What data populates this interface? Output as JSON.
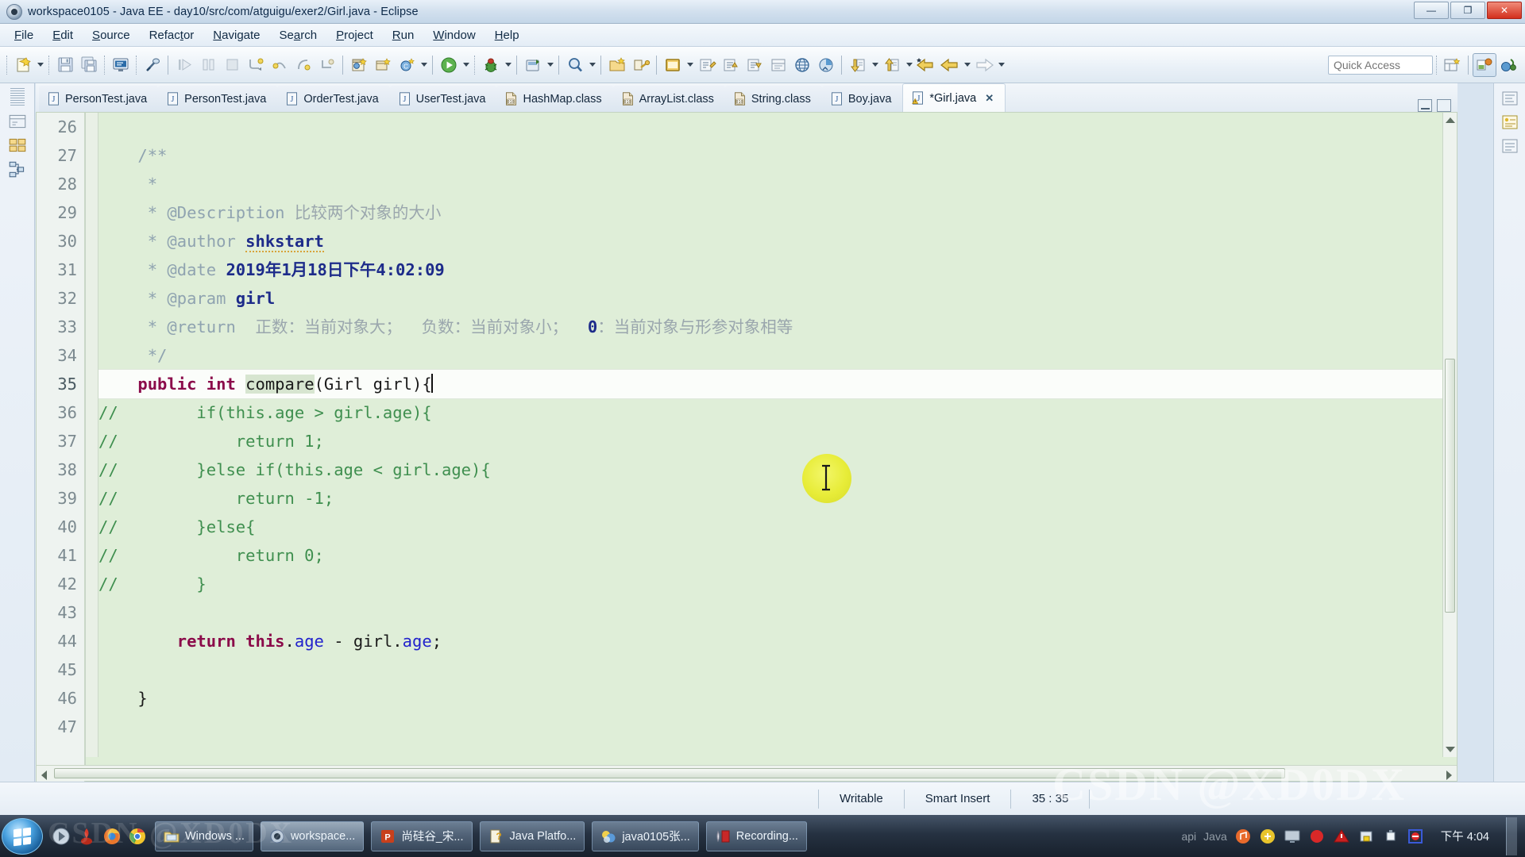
{
  "window": {
    "title": "workspace0105 - Java EE - day10/src/com/atguigu/exer2/Girl.java - Eclipse",
    "icon": "eclipse-icon",
    "minimize_label": "—",
    "maximize_label": "❐",
    "close_label": "✕"
  },
  "menu": {
    "items": [
      {
        "label": "File",
        "mnemonic": "F"
      },
      {
        "label": "Edit",
        "mnemonic": "E"
      },
      {
        "label": "Source",
        "mnemonic": "S"
      },
      {
        "label": "Refactor",
        "mnemonic": "t"
      },
      {
        "label": "Navigate",
        "mnemonic": "N"
      },
      {
        "label": "Search",
        "mnemonic": "a"
      },
      {
        "label": "Project",
        "mnemonic": "P"
      },
      {
        "label": "Run",
        "mnemonic": "R"
      },
      {
        "label": "Window",
        "mnemonic": "W"
      },
      {
        "label": "Help",
        "mnemonic": "H"
      }
    ]
  },
  "toolbar": {
    "quick_access_placeholder": "Quick Access",
    "quick_access_value": "",
    "buttons": [
      "new-wizard-icon",
      "new-dropdown-arrow",
      "save-icon",
      "save-all-icon",
      "print-icon",
      "toggle-mark-occurrences-icon",
      "resume-icon",
      "suspend-icon",
      "terminate-icon",
      "step-into-icon",
      "step-over-icon",
      "step-return-icon",
      "drop-to-frame-icon",
      "new-java-project-icon",
      "new-java-package-icon",
      "new-class-icon",
      "new-class-arrow",
      "open-type-icon",
      "run-icon",
      "run-arrow",
      "debug-icon",
      "debug-arrow",
      "external-tools-icon",
      "external-tools-arrow",
      "open-search-icon",
      "open-search-arrow",
      "new-folder-icon",
      "link-icon",
      "pin-editor-icon",
      "pin-arrow",
      "last-edit-location-icon",
      "previous-annotation-icon",
      "next-annotation-icon",
      "toggle-breadcrumb-icon",
      "toggle-block-selection-icon",
      "show-whitespace-icon",
      "search-web-icon",
      "coverage-icon",
      "previous-edit-icon",
      "previous-edit-arrow",
      "next-edit-icon",
      "next-edit-arrow",
      "back-icon",
      "back-arrow",
      "forward-icon",
      "forward-arrow"
    ],
    "perspective_buttons": [
      "open-perspective-icon",
      "java-ee-perspective-icon",
      "java-perspective-icon"
    ]
  },
  "editor_tabs": [
    {
      "label": "PersonTest.java",
      "icon": "java-file-icon",
      "active": false,
      "dirty": false
    },
    {
      "label": "PersonTest.java",
      "icon": "java-file-icon",
      "active": false,
      "dirty": false
    },
    {
      "label": "OrderTest.java",
      "icon": "java-file-icon",
      "active": false,
      "dirty": false
    },
    {
      "label": "UserTest.java",
      "icon": "java-file-icon",
      "active": false,
      "dirty": false
    },
    {
      "label": "HashMap.class",
      "icon": "class-file-icon",
      "active": false,
      "dirty": false
    },
    {
      "label": "ArrayList.class",
      "icon": "class-file-icon",
      "active": false,
      "dirty": false
    },
    {
      "label": "String.class",
      "icon": "class-file-icon",
      "active": false,
      "dirty": false
    },
    {
      "label": "Boy.java",
      "icon": "java-file-icon",
      "active": false,
      "dirty": false
    },
    {
      "label": "*Girl.java",
      "icon": "java-file-warning-icon",
      "active": true,
      "dirty": true,
      "close_label": "✕"
    }
  ],
  "editor": {
    "first_visible_line": 26,
    "lines": [
      {
        "n": 26,
        "fold": false,
        "highlight": false,
        "tokens": [
          {
            "t": "",
            "c": "plain"
          }
        ]
      },
      {
        "n": 27,
        "fold": true,
        "highlight": false,
        "tokens": [
          {
            "t": "    /**",
            "c": "jd"
          }
        ]
      },
      {
        "n": 28,
        "fold": false,
        "highlight": false,
        "tokens": [
          {
            "t": "     *",
            "c": "jd"
          }
        ]
      },
      {
        "n": 29,
        "fold": false,
        "highlight": false,
        "tokens": [
          {
            "t": "     * ",
            "c": "jd"
          },
          {
            "t": "@Description",
            "c": "jdk"
          },
          {
            "t": " 比较两个对象的大小",
            "c": "jdtxt"
          }
        ]
      },
      {
        "n": 30,
        "fold": false,
        "highlight": false,
        "tokens": [
          {
            "t": "     * ",
            "c": "jd"
          },
          {
            "t": "@author",
            "c": "jdk"
          },
          {
            "t": " ",
            "c": "jd"
          },
          {
            "t": "shkstart",
            "c": "spell"
          }
        ]
      },
      {
        "n": 31,
        "fold": false,
        "highlight": false,
        "tokens": [
          {
            "t": "     * ",
            "c": "jd"
          },
          {
            "t": "@date",
            "c": "jdk"
          },
          {
            "t": " 2019年1月18日下午4:02:09",
            "c": "bold-dark"
          }
        ]
      },
      {
        "n": 32,
        "fold": false,
        "highlight": false,
        "tokens": [
          {
            "t": "     * ",
            "c": "jd"
          },
          {
            "t": "@param",
            "c": "jdk"
          },
          {
            "t": " girl",
            "c": "bold-dark"
          }
        ]
      },
      {
        "n": 33,
        "fold": false,
        "highlight": false,
        "tokens": [
          {
            "t": "     * ",
            "c": "jd"
          },
          {
            "t": "@return",
            "c": "jdk"
          },
          {
            "t": "  正数：当前对象大；  负数：当前对象小；  ",
            "c": "jdtxt"
          },
          {
            "t": "0",
            "c": "bold-dark"
          },
          {
            "t": "：当前对象与形参对象相等",
            "c": "jdtxt"
          }
        ]
      },
      {
        "n": 34,
        "fold": false,
        "highlight": false,
        "tokens": [
          {
            "t": "     */",
            "c": "jd"
          }
        ]
      },
      {
        "n": 35,
        "fold": true,
        "highlight": true,
        "tokens": [
          {
            "t": "    ",
            "c": "plain"
          },
          {
            "t": "public",
            "c": "kw"
          },
          {
            "t": " ",
            "c": "plain"
          },
          {
            "t": "int",
            "c": "kw"
          },
          {
            "t": " ",
            "c": "plain"
          },
          {
            "t": "compare",
            "c": "mth"
          },
          {
            "t": "(Girl girl){",
            "c": "plain"
          }
        ],
        "caret": true
      },
      {
        "n": 36,
        "fold": false,
        "highlight": false,
        "tokens": [
          {
            "t": "//        if(this.age > girl.age){",
            "c": "cm"
          }
        ],
        "nogutterpad": true
      },
      {
        "n": 37,
        "fold": false,
        "highlight": false,
        "tokens": [
          {
            "t": "//            return 1;",
            "c": "cm"
          }
        ],
        "nogutterpad": true
      },
      {
        "n": 38,
        "fold": false,
        "highlight": false,
        "tokens": [
          {
            "t": "//        }else if(this.age < girl.age){",
            "c": "cm"
          }
        ],
        "nogutterpad": true
      },
      {
        "n": 39,
        "fold": false,
        "highlight": false,
        "tokens": [
          {
            "t": "//            return -1;",
            "c": "cm"
          }
        ],
        "nogutterpad": true
      },
      {
        "n": 40,
        "fold": false,
        "highlight": false,
        "tokens": [
          {
            "t": "//        }else{",
            "c": "cm"
          }
        ],
        "nogutterpad": true
      },
      {
        "n": 41,
        "fold": false,
        "highlight": false,
        "tokens": [
          {
            "t": "//            return 0;",
            "c": "cm"
          }
        ],
        "nogutterpad": true
      },
      {
        "n": 42,
        "fold": false,
        "highlight": false,
        "tokens": [
          {
            "t": "//        }",
            "c": "cm"
          }
        ],
        "nogutterpad": true
      },
      {
        "n": 43,
        "fold": false,
        "highlight": false,
        "tokens": [
          {
            "t": "",
            "c": "plain"
          }
        ]
      },
      {
        "n": 44,
        "fold": false,
        "highlight": false,
        "tokens": [
          {
            "t": "        ",
            "c": "plain"
          },
          {
            "t": "return",
            "c": "kw"
          },
          {
            "t": " ",
            "c": "plain"
          },
          {
            "t": "this",
            "c": "kw"
          },
          {
            "t": ".",
            "c": "plain"
          },
          {
            "t": "age",
            "c": "fld"
          },
          {
            "t": " - girl.",
            "c": "plain"
          },
          {
            "t": "age",
            "c": "fld"
          },
          {
            "t": ";",
            "c": "plain"
          }
        ]
      },
      {
        "n": 45,
        "fold": false,
        "highlight": false,
        "tokens": [
          {
            "t": "",
            "c": "plain"
          }
        ]
      },
      {
        "n": 46,
        "fold": false,
        "highlight": false,
        "tokens": [
          {
            "t": "    }",
            "c": "plain"
          }
        ]
      },
      {
        "n": 47,
        "fold": false,
        "highlight": false,
        "tokens": [
          {
            "t": "",
            "c": "plain"
          }
        ]
      }
    ]
  },
  "statusbar": {
    "writable": "Writable",
    "insert_mode": "Smart Insert",
    "position": "35 : 35"
  },
  "taskbar": {
    "start_label": "Start",
    "quick_launch": [
      "media-player-icon",
      "pdf-reader-icon",
      "firefox-icon",
      "chrome-icon"
    ],
    "buttons": [
      {
        "label": "Windows ...",
        "icon": "explorer-icon",
        "active": false
      },
      {
        "label": "workspace...",
        "icon": "eclipse-icon",
        "active": true
      },
      {
        "label": "尚硅谷_宋...",
        "icon": "powerpoint-icon",
        "active": false
      },
      {
        "label": "Java Platfo...",
        "icon": "help-doc-icon",
        "active": false
      },
      {
        "label": "java0105张...",
        "icon": "folder-icon",
        "active": false
      },
      {
        "label": "Recording...",
        "icon": "recorder-icon",
        "active": false
      }
    ],
    "tray": [
      "api-label",
      "java-label",
      "network-icon",
      "security-icon",
      "volume-icon",
      "usb-icon",
      "screenshot-icon"
    ],
    "api_label": "api",
    "java_label": "Java",
    "clock": "下午 4:04"
  },
  "watermark": {
    "main": "CSDN @XD0DX",
    "secondary": "CSDN @XD0DX"
  },
  "colors": {
    "keyword": "#8b0b4a",
    "comment": "#3f8f4f",
    "javadoc": "#8fa3b0",
    "field": "#2222cc",
    "editor_bg": "#dfeed8",
    "current_line": "#fbfdfa",
    "accent": "#1b6ac9"
  }
}
